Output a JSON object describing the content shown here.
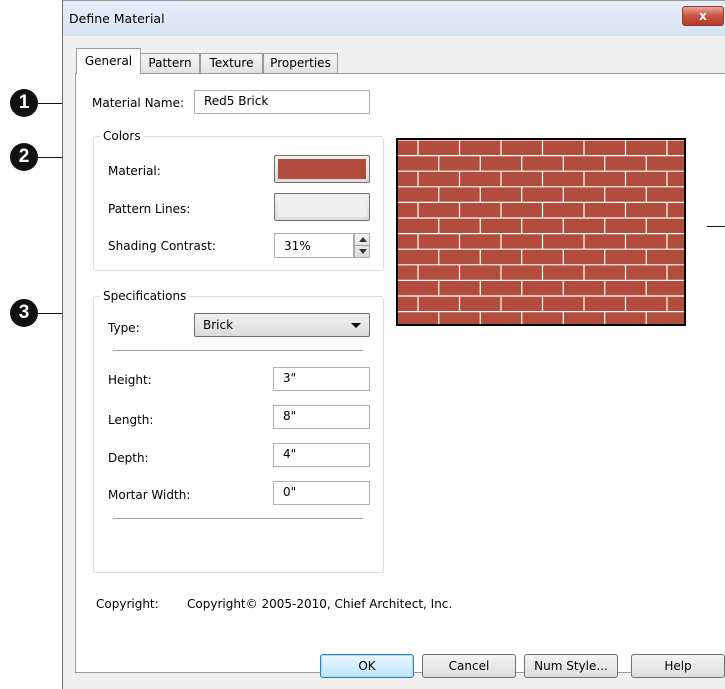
{
  "window": {
    "title": "Define Material",
    "close_glyph": "x"
  },
  "tabs": [
    "General",
    "Pattern",
    "Texture",
    "Properties"
  ],
  "general": {
    "material_name_label": "Material Name:",
    "material_name_value": "Red5 Brick",
    "colors": {
      "group_label": "Colors",
      "material_label": "Material:",
      "material_color": "#b24c3c",
      "pattern_lines_label": "Pattern Lines:",
      "pattern_lines_color": "#f0f0f0",
      "shading_contrast_label": "Shading Contrast:",
      "shading_contrast_value": "31%"
    },
    "specifications": {
      "group_label": "Specifications",
      "type_label": "Type:",
      "type_value": "Brick",
      "height_label": "Height:",
      "height_value": "3\"",
      "length_label": "Length:",
      "length_value": "8\"",
      "depth_label": "Depth:",
      "depth_value": "4\"",
      "mortar_width_label": "Mortar Width:",
      "mortar_width_value": "0\""
    },
    "copyright_label": "Copyright:",
    "copyright_value": "Copyright© 2005-2010, Chief Architect, Inc."
  },
  "preview": {
    "brick_color": "#b24c3c",
    "mortar_color": "#ffffff"
  },
  "buttons": {
    "ok": "OK",
    "cancel": "Cancel",
    "num_style": "Num Style...",
    "help": "Help"
  },
  "callouts": [
    "1",
    "2",
    "3"
  ]
}
